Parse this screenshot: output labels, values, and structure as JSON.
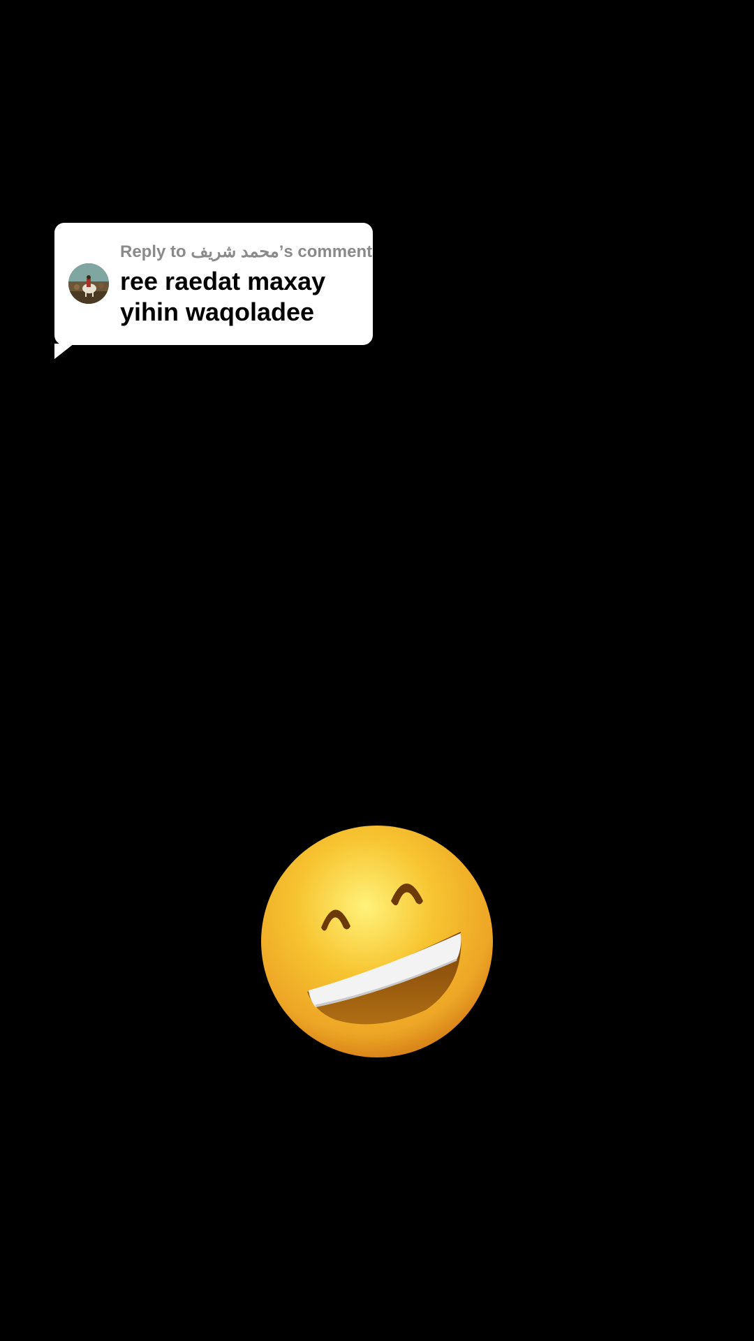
{
  "reply_bubble": {
    "reply_label": "Reply to محمد شريف’s comment",
    "comment_text": "ree raedat maxay yihin waqoladee",
    "avatar_icon": "user-avatar"
  },
  "emoji": {
    "icon": "grinning-face-with-smiling-eyes-emoji",
    "colors": {
      "face": "#f7c531",
      "face_edge": "#e59a1a",
      "mouth": "#9a5a10",
      "teeth": "#f2f2f2"
    }
  },
  "background": "#000000"
}
